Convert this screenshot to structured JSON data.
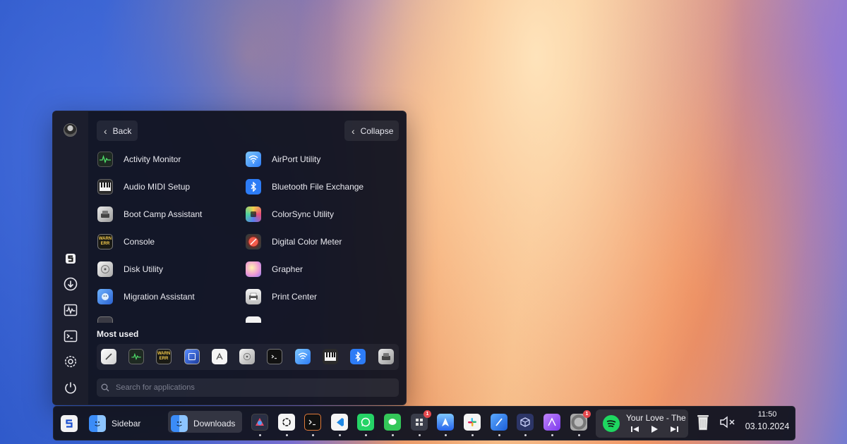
{
  "launcher": {
    "back_label": "Back",
    "collapse_label": "Collapse",
    "apps_left": [
      "Activity Monitor",
      "Audio MIDI Setup",
      "Boot Camp Assistant",
      "Console",
      "Disk Utility",
      "Migration Assistant"
    ],
    "apps_right": [
      "AirPort Utility",
      "Bluetooth File Exchange",
      "ColorSync Utility",
      "Digital Color Meter",
      "Grapher",
      "Print Center"
    ],
    "most_used_label": "Most used",
    "most_used_icons": [
      "script-editor-icon",
      "activity-monitor-icon",
      "console-icon",
      "screenshot-icon",
      "app-store-icon",
      "disk-utility-icon",
      "terminal-icon",
      "airport-utility-icon",
      "audio-midi-icon",
      "bluetooth-icon",
      "boot-camp-icon"
    ],
    "search_placeholder": "Search for applications",
    "rail_icons": [
      "avatar",
      "app-logo-icon",
      "download-icon",
      "activity-icon",
      "terminal-icon",
      "settings-icon",
      "power-icon"
    ]
  },
  "dock": {
    "sidebar_label": "Sidebar",
    "downloads_label": "Downloads",
    "apps": [
      {
        "name": "photos-icon",
        "badge": ""
      },
      {
        "name": "chatgpt-icon",
        "badge": ""
      },
      {
        "name": "terminal-icon",
        "badge": ""
      },
      {
        "name": "vscode-icon",
        "badge": ""
      },
      {
        "name": "whatsapp-icon",
        "badge": ""
      },
      {
        "name": "messages-icon",
        "badge": ""
      },
      {
        "name": "tasks-icon",
        "badge": "1"
      },
      {
        "name": "testflight-icon",
        "badge": ""
      },
      {
        "name": "slack-icon",
        "badge": ""
      },
      {
        "name": "xcode-icon",
        "badge": ""
      },
      {
        "name": "virtualbox-icon",
        "badge": ""
      },
      {
        "name": "affinity-icon",
        "badge": ""
      },
      {
        "name": "system-settings-icon",
        "badge": "1"
      }
    ],
    "now_playing": "Your Love - The",
    "time": "11:50",
    "date": "03.10.2024"
  },
  "colors": {
    "panel_bg": "#12141f",
    "accent_blue": "#2d7cf6",
    "spotify_green": "#1ed760",
    "badge_red": "#e5484d"
  }
}
